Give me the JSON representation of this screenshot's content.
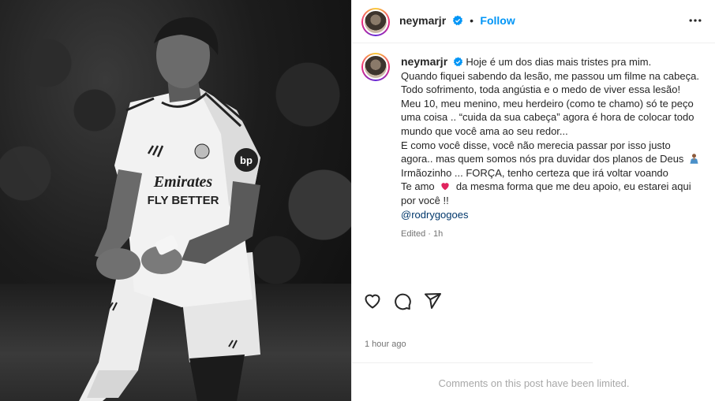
{
  "post": {
    "image": {
      "description_icon": "player-photo",
      "jersey_sponsor_lines": [
        "Emirates",
        "FLY BETTER"
      ]
    },
    "author": {
      "username": "neymarjr",
      "verified": true,
      "follow_label": "Follow",
      "separator": "•"
    },
    "caption": {
      "username": "neymarjr",
      "lines": [
        "Hoje é um dos dias mais tristes pra mim.",
        "Quando fiquei sabendo da lesão, me passou um filme na cabeça.",
        "Todo sofrimento, toda angústia e o medo de viver essa lesão!",
        "Meu 10, meu menino, meu herdeiro (como te chamo) só te peço",
        "uma coisa .. “cuida da sua cabeça” agora é hora de colocar todo",
        "mundo que você ama ao seu redor...",
        "E como você disse, você não merecia passar por isso justo",
        "agora.. mas quem somos nós pra duvidar dos planos de Deus",
        "Irmãozinho ... FORÇA, tenho certeza que irá voltar voando",
        "Te amo",
        "da mesma forma que me deu apoio, eu estarei aqui",
        "por você !!"
      ],
      "mention": "@rodrygogoes",
      "edited": "Edited",
      "edited_sep": "·",
      "edited_age": "1h"
    },
    "actions": {
      "like_icon": "heart-icon",
      "comment_icon": "comment-icon",
      "share_icon": "send-icon"
    },
    "timestamp": "1 hour ago",
    "comments_notice": "Comments on this post have been limited."
  },
  "colors": {
    "link_blue": "#0095f6",
    "mention_blue": "#00376b",
    "heart_red": "#e0245e",
    "muted": "#737373",
    "text": "#262626"
  }
}
